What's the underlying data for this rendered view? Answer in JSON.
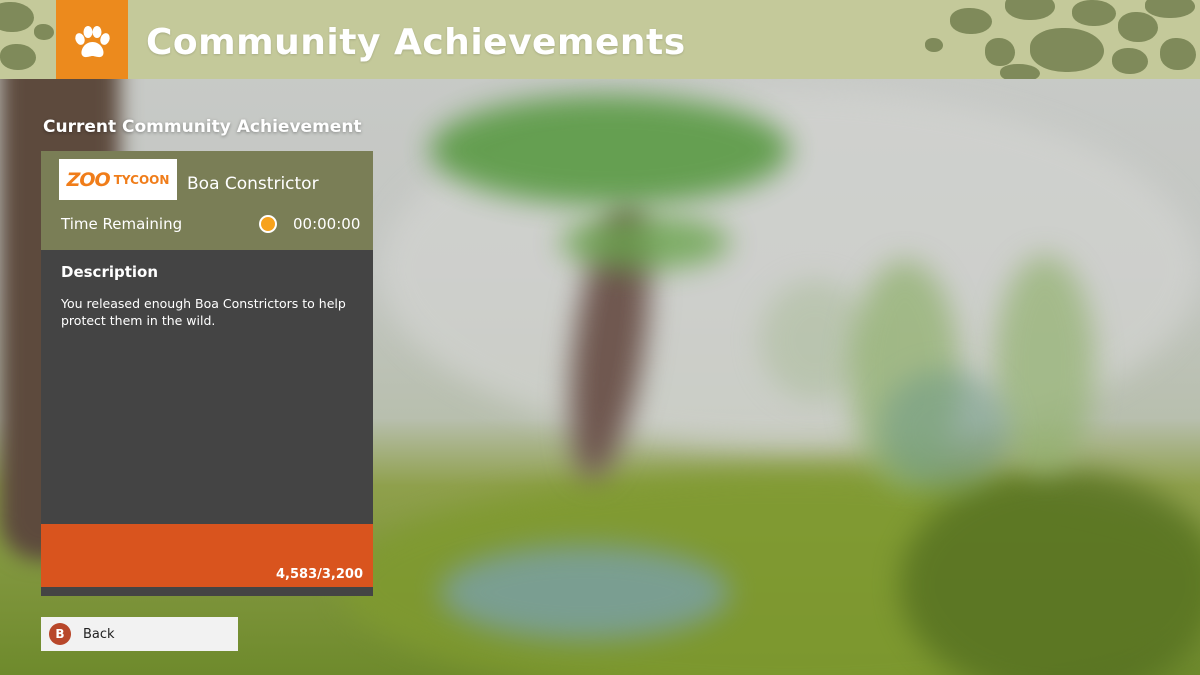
{
  "header": {
    "title": "Community Achievements",
    "icon": "paw-icon"
  },
  "panel": {
    "heading": "Current Community Achievement",
    "logo": {
      "brand_main": "ZOO",
      "brand_sub": "TYCOON"
    },
    "achievement_name": "Boa Constrictor",
    "time_label": "Time Remaining",
    "time_value": "00:00:00",
    "time_indicator_color": "#f7a21c",
    "description_heading": "Description",
    "description_text": "You released enough Boa Constrictors to help protect them in the wild.",
    "progress": {
      "current": 4583,
      "target": 3200,
      "display": "4,583/3,200",
      "fill_fraction": 1.0,
      "fill_color": "#d9541e"
    }
  },
  "footer": {
    "back_button_glyph": "B",
    "back_button_label": "Back"
  },
  "colors": {
    "accent_orange": "#ec8a1d",
    "header_bg": "#c4c99a",
    "card_top": "#7a7e56",
    "card_body": "#444444"
  }
}
